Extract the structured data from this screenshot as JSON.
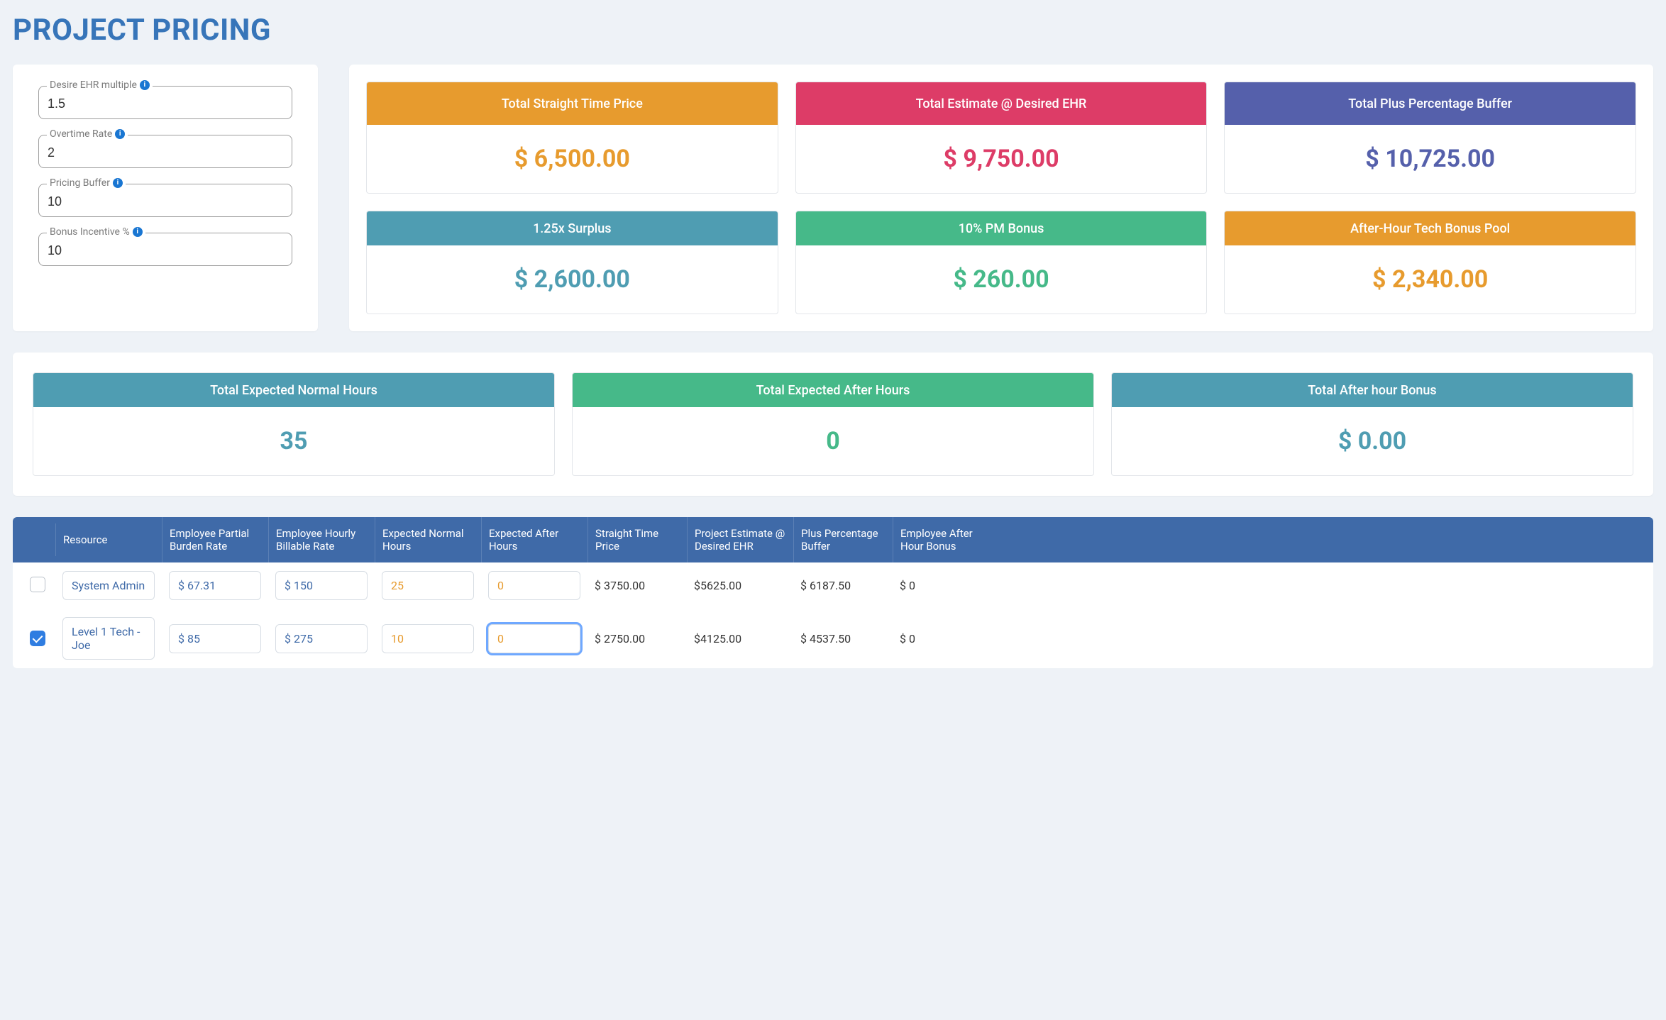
{
  "title": "PROJECT PRICING",
  "inputs": {
    "ehr_multiple": {
      "label": "Desire EHR multiple",
      "value": "1.5"
    },
    "overtime_rate": {
      "label": "Overtime Rate",
      "value": "2"
    },
    "pricing_buffer": {
      "label": "Pricing Buffer",
      "value": "10"
    },
    "bonus_incentive": {
      "label": "Bonus Incentive %",
      "value": "10"
    }
  },
  "stats": {
    "straight_time": {
      "label": "Total Straight Time Price",
      "value": "$ 6,500.00"
    },
    "estimate_ehr": {
      "label": "Total Estimate @ Desired EHR",
      "value": "$ 9,750.00"
    },
    "plus_buffer": {
      "label": "Total Plus Percentage Buffer",
      "value": "$ 10,725.00"
    },
    "surplus": {
      "label": "1.25x Surplus",
      "value": "$ 2,600.00"
    },
    "pm_bonus": {
      "label": "10% PM Bonus",
      "value": "$ 260.00"
    },
    "tech_bonus": {
      "label": "After-Hour Tech Bonus Pool",
      "value": "$ 2,340.00"
    }
  },
  "summary": {
    "normal_hours": {
      "label": "Total Expected Normal Hours",
      "value": "35"
    },
    "after_hours": {
      "label": "Total Expected After Hours",
      "value": "0"
    },
    "after_bonus": {
      "label": "Total After hour Bonus",
      "value": "$ 0.00"
    }
  },
  "table": {
    "headers": {
      "resource": "Resource",
      "burden": "Employee Partial Burden Rate",
      "billable": "Employee Hourly Billable Rate",
      "normal": "Expected Normal Hours",
      "after": "Expected After Hours",
      "straight": "Straight Time Price",
      "estimate": "Project Estimate @ Desired EHR",
      "buffer": "Plus Percentage Buffer",
      "bonus": "Employee After Hour Bonus"
    },
    "rows": [
      {
        "checked": false,
        "resource": "System Admin",
        "burden": "$ 67.31",
        "billable": "$ 150",
        "normal": "25",
        "after": "0",
        "after_focused": false,
        "straight": "$ 3750.00",
        "estimate": "$5625.00",
        "buffer": "$ 6187.50",
        "bonus": "$ 0"
      },
      {
        "checked": true,
        "resource": "Level 1 Tech - Joe",
        "burden": "$ 85",
        "billable": "$ 275",
        "normal": "10",
        "after": "0",
        "after_focused": true,
        "straight": "$ 2750.00",
        "estimate": "$4125.00",
        "buffer": "$ 4537.50",
        "bonus": "$ 0"
      }
    ]
  }
}
